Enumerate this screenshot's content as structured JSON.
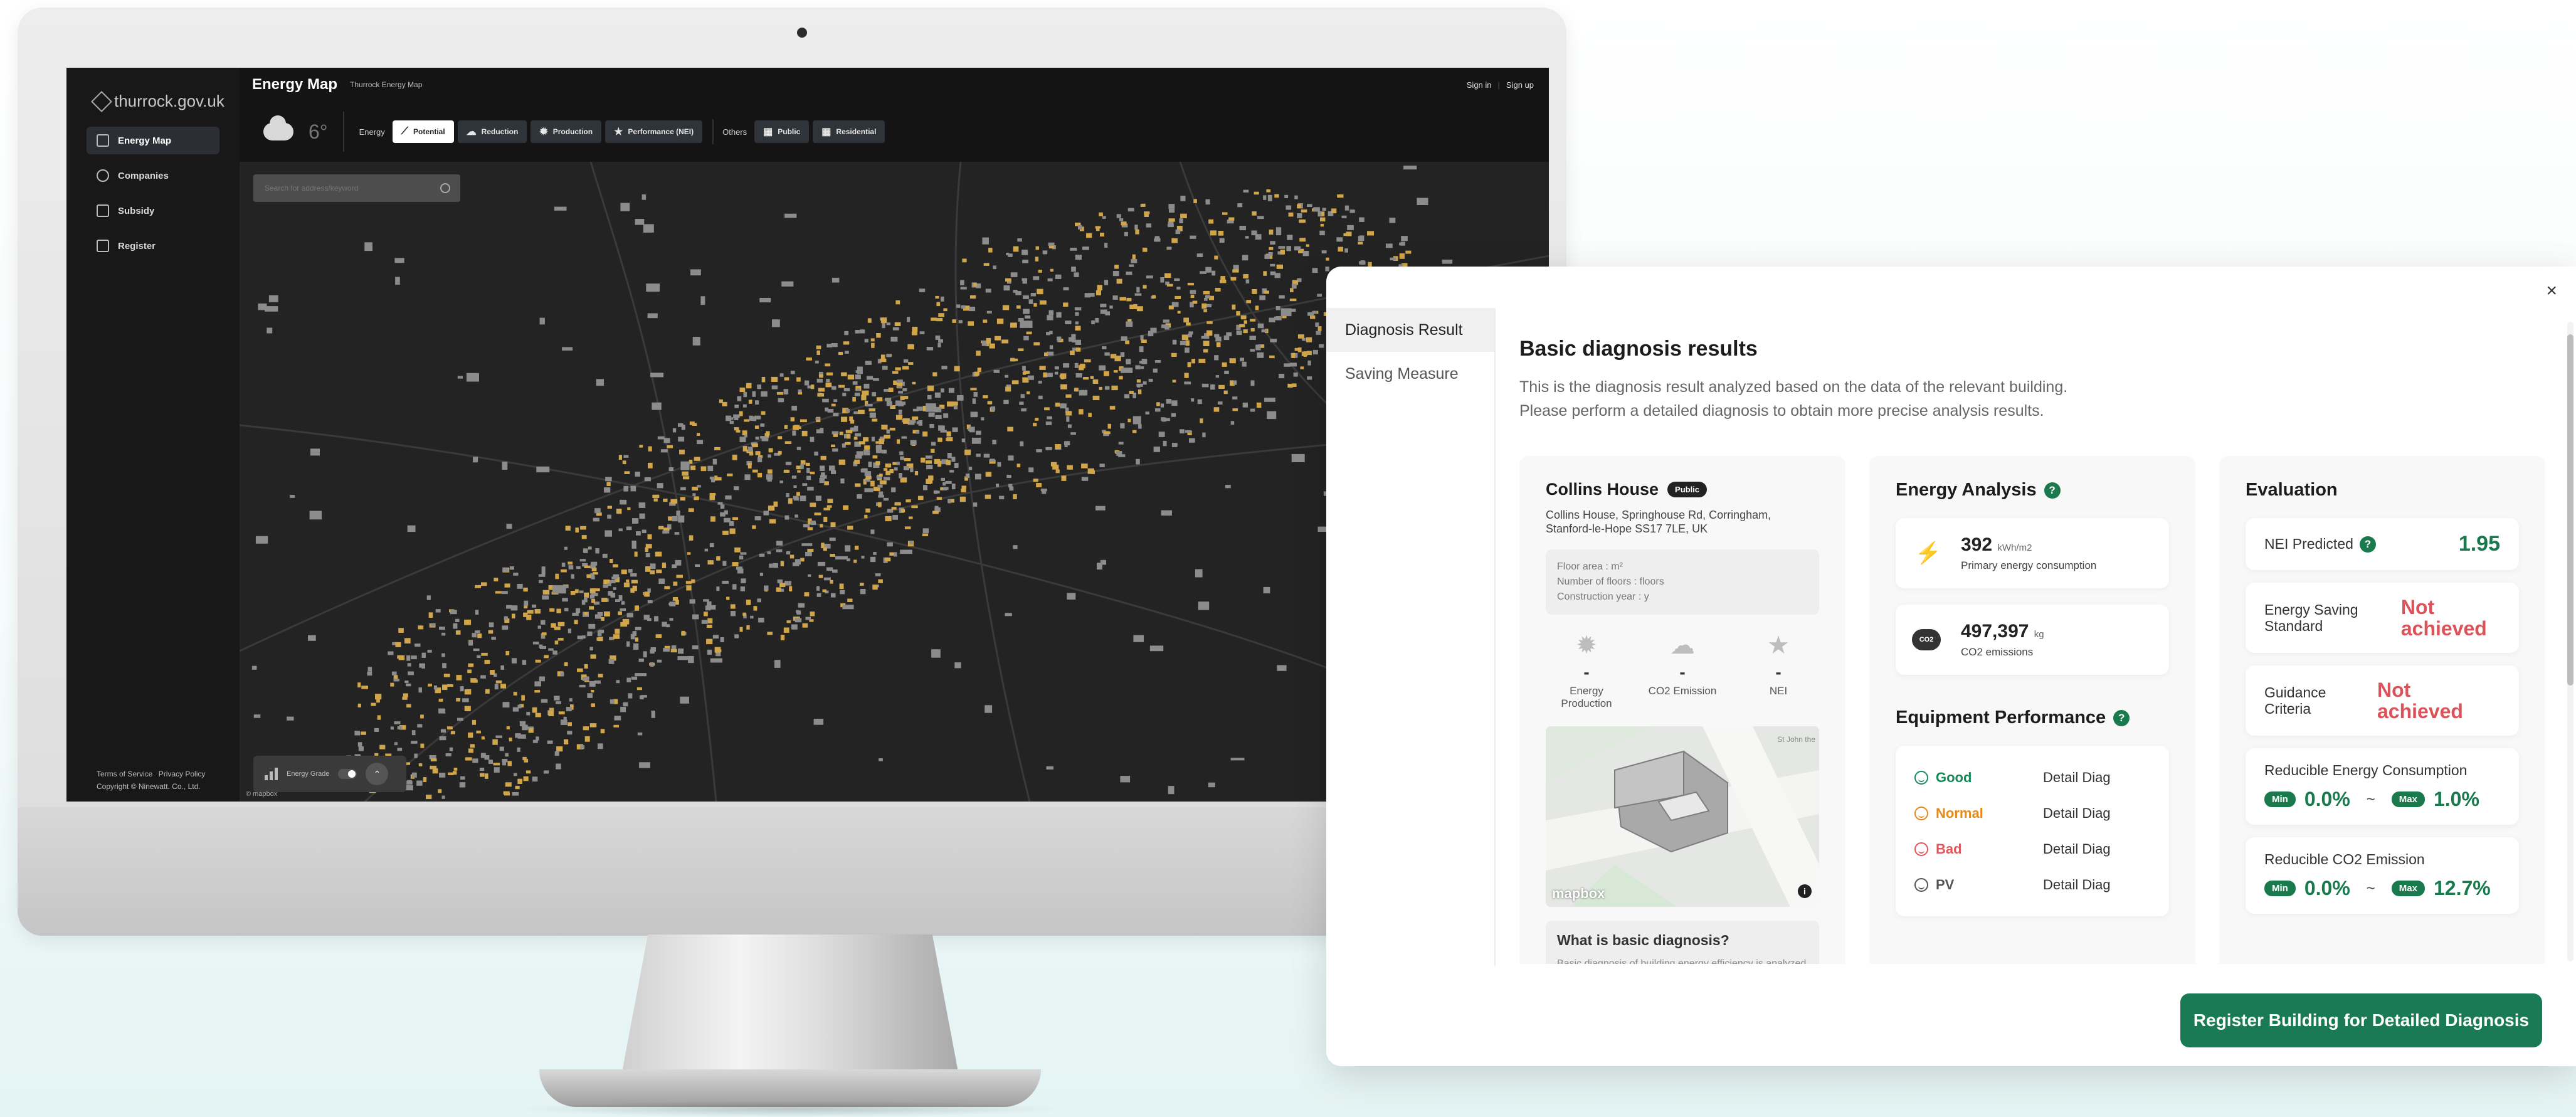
{
  "sidebar": {
    "logo": "thurrock.gov.uk",
    "items": [
      {
        "label": "Energy Map",
        "active": true
      },
      {
        "label": "Companies"
      },
      {
        "label": "Subsidy"
      },
      {
        "label": "Register"
      }
    ],
    "footer": {
      "terms": "Terms of Service",
      "privacy": "Privacy Policy",
      "copyright": "Copyright © Ninewatt. Co., Ltd."
    }
  },
  "header": {
    "title": "Energy Map",
    "subtitle": "Thurrock Energy Map",
    "sign_in": "Sign in",
    "sign_up": "Sign up"
  },
  "filters": {
    "temperature": "6°",
    "energy_label": "Energy",
    "energy_buttons": [
      {
        "label": "Potential",
        "active": true
      },
      {
        "label": "Reduction"
      },
      {
        "label": "Production"
      },
      {
        "label": "Performance (NEI)"
      }
    ],
    "others_label": "Others",
    "other_buttons": [
      {
        "label": "Public"
      },
      {
        "label": "Residential"
      }
    ]
  },
  "map": {
    "search_placeholder": "Search for address/keyword",
    "legend_label": "Energy Grade",
    "attribution": "© mapbox",
    "palette": {
      "background": "#232323",
      "buildings_lit": "#d1a54a",
      "buildings": "#8c8c8c"
    }
  },
  "panel": {
    "tabs": [
      {
        "label": "Diagnosis Result",
        "active": true
      },
      {
        "label": "Saving Measure"
      }
    ],
    "title": "Basic diagnosis results",
    "desc1": "This is the diagnosis result analyzed based on the data of the relevant building.",
    "desc2": "Please perform a detailed diagnosis to obtain more precise analysis results.",
    "building": {
      "name": "Collins House",
      "badge": "Public",
      "address": "Collins House, Springhouse Rd, Corringham, Stanford-le-Hope SS17 7LE, UK",
      "floor_area": "Floor area : m²",
      "floors": "Number of floors : floors",
      "year": "Construction year : y",
      "metrics": [
        {
          "icon": "production-icon",
          "value": "-",
          "label": "Energy Production"
        },
        {
          "icon": "co2-emission-icon",
          "value": "-",
          "label": "CO2 Emission"
        },
        {
          "icon": "star-icon",
          "value": "-",
          "label": "NEI"
        }
      ],
      "map_attribution": "mapbox",
      "map_label": "St John the",
      "what_title": "What is basic diagnosis?",
      "what_desc": "Basic diagnosis of building energy efficiency is analyzed based on the minimum data such as"
    },
    "energy": {
      "title": "Energy Analysis",
      "primary_value": "392",
      "primary_unit": "kWh/m2",
      "primary_label": "Primary energy consumption",
      "co2_value": "497,397",
      "co2_unit": "kg",
      "co2_label": "CO2 emissions",
      "co2_glyph": "CO2"
    },
    "equipment": {
      "title": "Equipment Performance",
      "rows": [
        {
          "status": "Good",
          "action": "Detail Diag",
          "color": "#1a8a5a"
        },
        {
          "status": "Normal",
          "action": "Detail Diag",
          "color": "#e58a1f"
        },
        {
          "status": "Bad",
          "action": "Detail Diag",
          "color": "#e2565c"
        },
        {
          "status": "PV",
          "action": "Detail Diag",
          "color": "#555555"
        }
      ]
    },
    "evaluation": {
      "title": "Evaluation",
      "nei_label": "NEI Predicted",
      "nei_value": "1.95",
      "saving_label": "Energy Saving Standard",
      "saving_value": "Not achieved",
      "guidance_label": "Guidance Criteria",
      "guidance_value": "Not achieved",
      "reducible_energy": {
        "title": "Reducible Energy Consumption",
        "min": "0.0%",
        "max": "1.0%"
      },
      "reducible_co2": {
        "title": "Reducible CO2 Emission",
        "min": "0.0%",
        "max": "12.7%"
      },
      "min_label": "Min",
      "max_label": "Max",
      "tilde": "~"
    },
    "register_button": "Register Building for Detailed Diagnosis",
    "close_glyph": "×"
  }
}
